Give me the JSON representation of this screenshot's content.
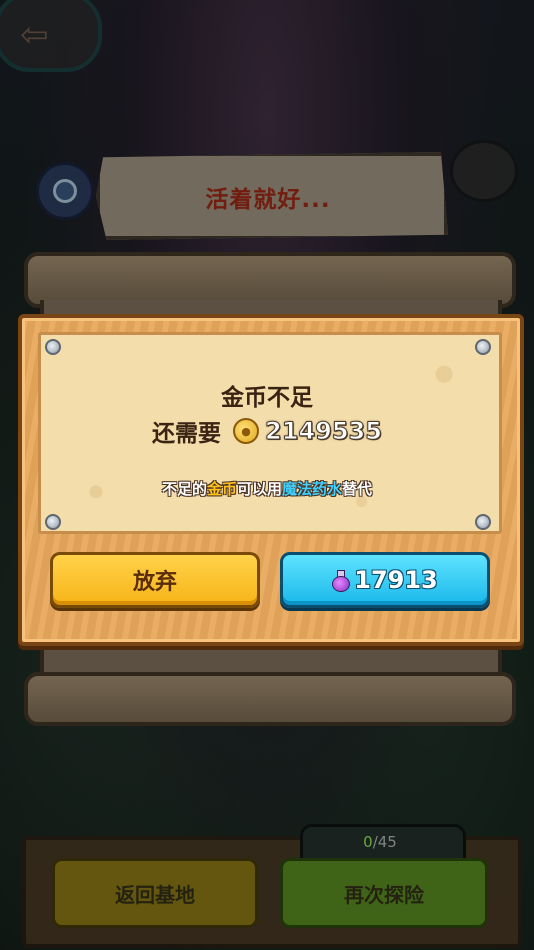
{
  "header": {
    "title": "活着就好..."
  },
  "dialog": {
    "message": "金币不足",
    "need_label": "还需要",
    "need_amount": "2149535",
    "hint": {
      "part1": "不足的",
      "gold_word": "金币",
      "part2": "可以用",
      "potion_word": "魔法药水",
      "part3": "替代"
    },
    "abandon_label": "放弃",
    "potion_amount": "17913"
  },
  "progress": {
    "current": "0",
    "separator": "/",
    "total": "45"
  },
  "bottom": {
    "return_label": "返回基地",
    "retry_label": "再次探险"
  },
  "colors": {
    "gold_accent": "#ffc21a",
    "potion_accent": "#3fd0ff",
    "abandon_button": "#f7b417",
    "potion_button": "#19b8ea"
  }
}
